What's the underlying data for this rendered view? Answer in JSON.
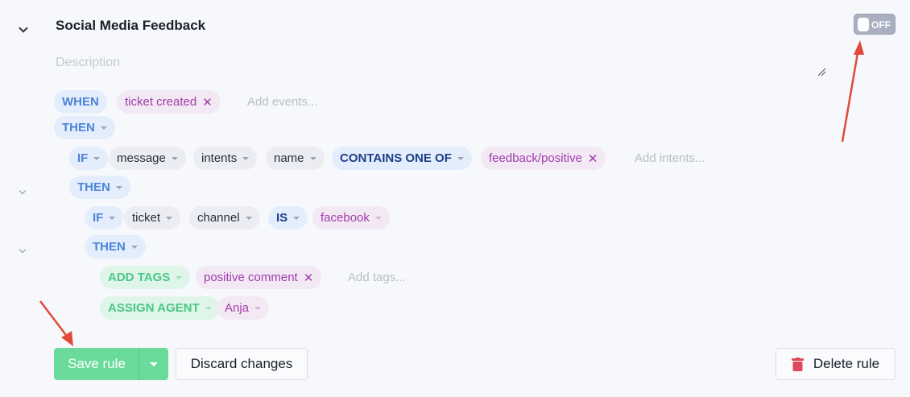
{
  "rule": {
    "title": "Social Media Feedback",
    "toggle_label": "OFF",
    "description_placeholder": "Description"
  },
  "trigger": {
    "when_label": "WHEN",
    "event": "ticket created",
    "events_placeholder": "Add events...",
    "then_label": "THEN"
  },
  "condition1": {
    "if_label": "IF",
    "fields": [
      "message",
      "intents",
      "name"
    ],
    "operator": "CONTAINS ONE OF",
    "value": "feedback/positive",
    "value_placeholder": "Add intents...",
    "then_label": "THEN"
  },
  "condition2": {
    "if_label": "IF",
    "fields": [
      "ticket",
      "channel"
    ],
    "operator": "IS",
    "value": "facebook",
    "then_label": "THEN"
  },
  "actions": {
    "add_tags_label": "ADD TAGS",
    "tag": "positive comment",
    "tags_placeholder": "Add tags...",
    "assign_agent_label": "ASSIGN AGENT",
    "agent": "Anja"
  },
  "buttons": {
    "save": "Save rule",
    "discard": "Discard changes",
    "delete": "Delete rule"
  },
  "colors": {
    "keyword": "#4a84d8",
    "tag": "#a23ba8",
    "action": "#49c883",
    "save_button": "#6bdb9b",
    "delete_icon": "#e0475b",
    "annotation_arrow": "#e04a3a"
  }
}
